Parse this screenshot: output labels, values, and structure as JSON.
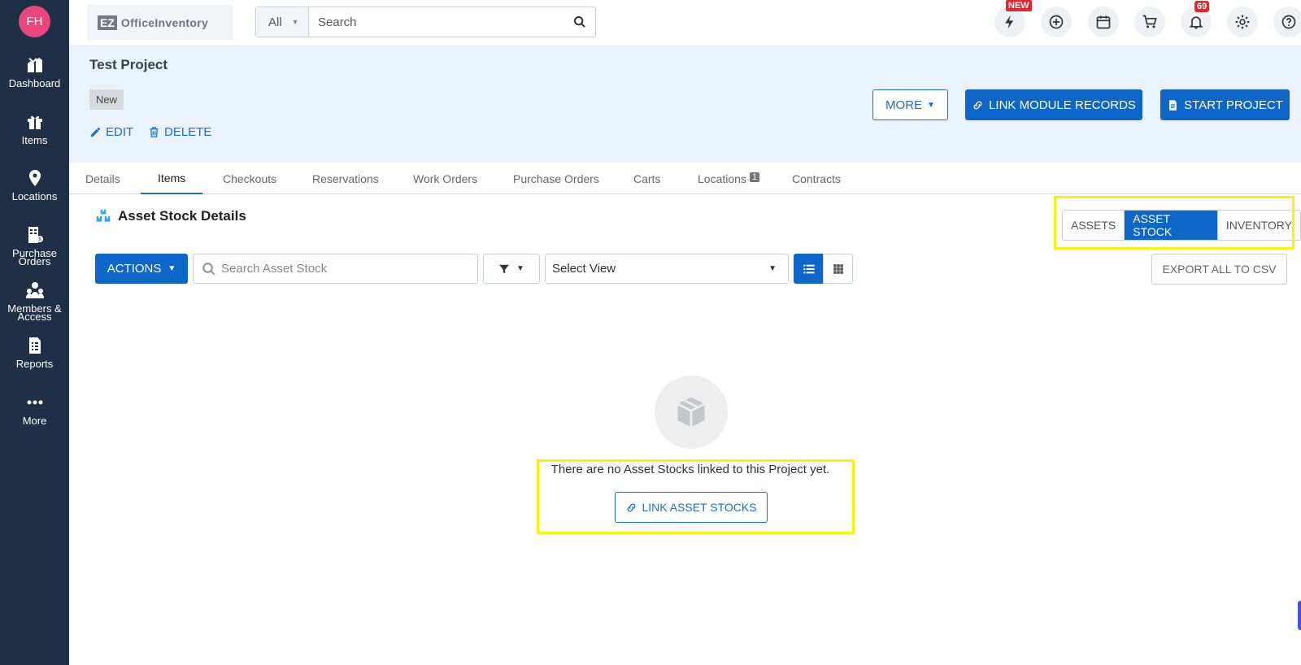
{
  "user": {
    "initials": "FH",
    "avatar_color": "#e8467c"
  },
  "sidebar": {
    "items": [
      {
        "label": "Dashboard",
        "icon": "dashboard-icon"
      },
      {
        "label": "Items",
        "icon": "gift-icon"
      },
      {
        "label": "Locations",
        "icon": "map-pin-icon"
      },
      {
        "label_line1": "Purchase",
        "label_line2": "Orders",
        "icon": "purchase-orders-icon"
      },
      {
        "label_line1": "Members &",
        "label_line2": "Access",
        "icon": "members-icon"
      },
      {
        "label": "Reports",
        "icon": "reports-icon"
      },
      {
        "label": "More",
        "icon": "ellipsis-icon"
      }
    ]
  },
  "topbar": {
    "logo_badge": "EZ",
    "logo_text": "OfficeInventory",
    "search_scope": "All",
    "search_placeholder": "Search",
    "new_badge": "NEW",
    "notification_count": "69"
  },
  "project": {
    "title": "Test Project",
    "status": "New",
    "edit_label": "EDIT",
    "delete_label": "DELETE",
    "more_label": "MORE",
    "link_module_label": "LINK MODULE RECORDS",
    "start_label": "START PROJECT"
  },
  "tabs": [
    {
      "label": "Details"
    },
    {
      "label": "Items",
      "active": true
    },
    {
      "label": "Checkouts"
    },
    {
      "label": "Reservations"
    },
    {
      "label": "Work Orders"
    },
    {
      "label": "Purchase Orders"
    },
    {
      "label": "Carts"
    },
    {
      "label": "Locations",
      "count": "1"
    },
    {
      "label": "Contracts"
    }
  ],
  "section": {
    "title": "Asset Stock Details",
    "toggles": [
      "ASSETS",
      "ASSET STOCK",
      "INVENTORY"
    ],
    "active_toggle": "ASSET STOCK",
    "actions_label": "ACTIONS",
    "search_placeholder": "Search Asset Stock",
    "select_view": "Select View",
    "export_label": "EXPORT ALL TO CSV",
    "empty_message": "There are no Asset Stocks linked to this Project yet.",
    "link_stocks_label": "LINK ASSET STOCKS"
  },
  "colors": {
    "sidebar": "#1f3046",
    "primary": "#0f66c9",
    "header_bg": "#e9f2fd",
    "highlight": "#f7f20f"
  }
}
